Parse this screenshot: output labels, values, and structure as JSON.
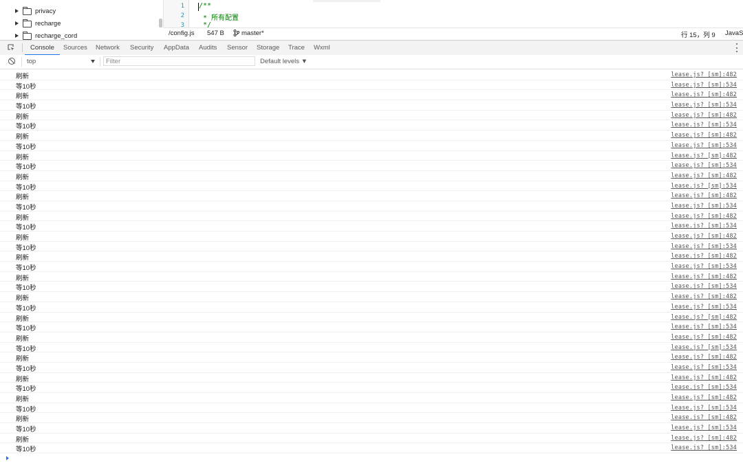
{
  "file_tree": {
    "items": [
      {
        "label": "privacy"
      },
      {
        "label": "recharge"
      },
      {
        "label": "recharge_cord"
      }
    ]
  },
  "editor": {
    "line_numbers": [
      "1",
      "2",
      "3"
    ],
    "lines": [
      "/**",
      " * 所有配置",
      " */"
    ]
  },
  "statusbar": {
    "file": "/config.js",
    "size": "547 B",
    "branch_icon": "git-branch-icon",
    "branch": "master*",
    "position": "行 15，列 9",
    "language": "JavaS"
  },
  "devtools_tabs": [
    "Console",
    "Sources",
    "Network",
    "Security",
    "AppData",
    "Audits",
    "Sensor",
    "Storage",
    "Trace",
    "Wxml"
  ],
  "active_tab": "Console",
  "accent_color": "#1a73e8",
  "console_toolbar": {
    "context": "top",
    "filter_placeholder": "Filter",
    "levels": "Default levels ▼"
  },
  "messages": [
    {
      "text": "刷新",
      "source": "lease.js? [sm]:482"
    },
    {
      "text": "等10秒",
      "source": "lease.js? [sm]:534"
    },
    {
      "text": "刷新",
      "source": "lease.js? [sm]:482"
    },
    {
      "text": "等10秒",
      "source": "lease.js? [sm]:534"
    },
    {
      "text": "刷新",
      "source": "lease.js? [sm]:482"
    },
    {
      "text": "等10秒",
      "source": "lease.js? [sm]:534"
    },
    {
      "text": "刷新",
      "source": "lease.js? [sm]:482"
    },
    {
      "text": "等10秒",
      "source": "lease.js? [sm]:534"
    },
    {
      "text": "刷新",
      "source": "lease.js? [sm]:482"
    },
    {
      "text": "等10秒",
      "source": "lease.js? [sm]:534"
    },
    {
      "text": "刷新",
      "source": "lease.js? [sm]:482"
    },
    {
      "text": "等10秒",
      "source": "lease.js? [sm]:534"
    },
    {
      "text": "刷新",
      "source": "lease.js? [sm]:482"
    },
    {
      "text": "等10秒",
      "source": "lease.js? [sm]:534"
    },
    {
      "text": "刷新",
      "source": "lease.js? [sm]:482"
    },
    {
      "text": "等10秒",
      "source": "lease.js? [sm]:534"
    },
    {
      "text": "刷新",
      "source": "lease.js? [sm]:482"
    },
    {
      "text": "等10秒",
      "source": "lease.js? [sm]:534"
    },
    {
      "text": "刷新",
      "source": "lease.js? [sm]:482"
    },
    {
      "text": "等10秒",
      "source": "lease.js? [sm]:534"
    },
    {
      "text": "刷新",
      "source": "lease.js? [sm]:482"
    },
    {
      "text": "等10秒",
      "source": "lease.js? [sm]:534"
    },
    {
      "text": "刷新",
      "source": "lease.js? [sm]:482"
    },
    {
      "text": "等10秒",
      "source": "lease.js? [sm]:534"
    },
    {
      "text": "刷新",
      "source": "lease.js? [sm]:482"
    },
    {
      "text": "等10秒",
      "source": "lease.js? [sm]:534"
    },
    {
      "text": "刷新",
      "source": "lease.js? [sm]:482"
    },
    {
      "text": "等10秒",
      "source": "lease.js? [sm]:534"
    },
    {
      "text": "刷新",
      "source": "lease.js? [sm]:482"
    },
    {
      "text": "等10秒",
      "source": "lease.js? [sm]:534"
    },
    {
      "text": "刷新",
      "source": "lease.js? [sm]:482"
    },
    {
      "text": "等10秒",
      "source": "lease.js? [sm]:534"
    },
    {
      "text": "刷新",
      "source": "lease.js? [sm]:482"
    },
    {
      "text": "等10秒",
      "source": "lease.js? [sm]:534"
    },
    {
      "text": "刷新",
      "source": "lease.js? [sm]:482"
    },
    {
      "text": "等10秒",
      "source": "lease.js? [sm]:534"
    },
    {
      "text": "刷新",
      "source": "lease.js? [sm]:482"
    },
    {
      "text": "等10秒",
      "source": "lease.js? [sm]:534"
    }
  ]
}
